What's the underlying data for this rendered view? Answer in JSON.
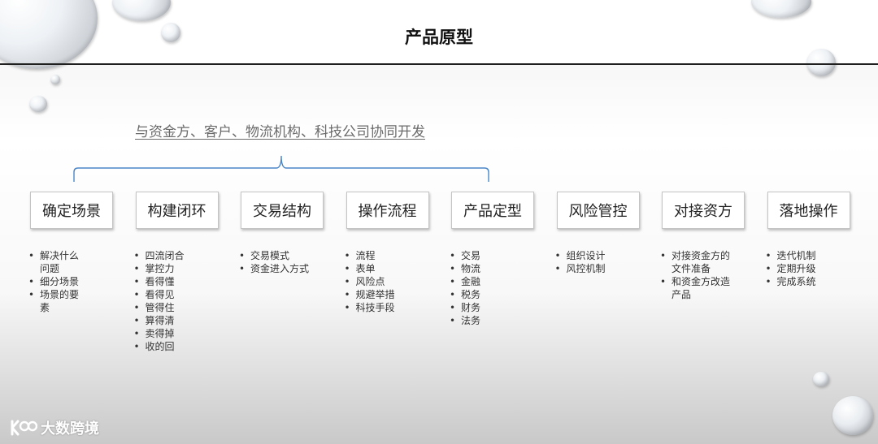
{
  "title": "产品原型",
  "subtitle": "与资金方、客户、物流机构、科技公司协同开发",
  "steps": [
    {
      "label": "确定场景",
      "items": [
        "解决什么问题",
        "细分场景",
        "场景的要素"
      ]
    },
    {
      "label": "构建闭环",
      "items": [
        "四流闭合",
        "掌控力",
        "看得懂",
        "看得见",
        "管得住",
        "算得清",
        "卖得掉",
        "收的回"
      ]
    },
    {
      "label": "交易结构",
      "items": [
        "交易模式",
        "资金进入方式"
      ]
    },
    {
      "label": "操作流程",
      "items": [
        "流程",
        "表单",
        "风险点",
        "规避举措",
        "科技手段"
      ]
    },
    {
      "label": "产品定型",
      "items": [
        "交易",
        "物流",
        "金融",
        "税务",
        "财务",
        "法务"
      ]
    },
    {
      "label": "风险管控",
      "items": [
        "组织设计",
        "风控机制"
      ]
    },
    {
      "label": "对接资方",
      "items": [
        "对接资金方的文件准备",
        "和资金方改造产品"
      ]
    },
    {
      "label": "落地操作",
      "items": [
        "迭代机制",
        "定期升级",
        "完成系统"
      ]
    }
  ],
  "watermark": "大数跨境",
  "colors": {
    "bracket": "#4a86c8",
    "rule": "#1f1f1f",
    "box_border": "#c4c4c4"
  }
}
